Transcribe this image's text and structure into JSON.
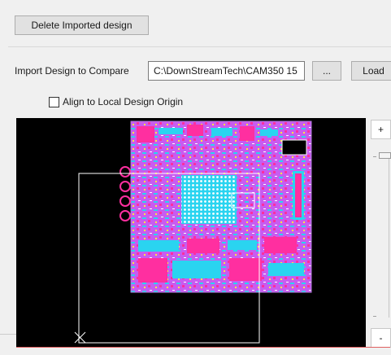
{
  "toolbar": {
    "delete_label": "Delete Imported design"
  },
  "import": {
    "label": "Import Design to Compare",
    "path_value": "C:\\DownStreamTech\\CAM350 15",
    "browse_label": "...",
    "load_label": "Load"
  },
  "options": {
    "align_label": "Align to Local Design Origin",
    "align_checked": false
  },
  "zoom": {
    "in_label": "+",
    "out_label": "-"
  },
  "colors": {
    "board": "#c85cf0",
    "copper_a": "#ff2fa0",
    "copper_b": "#2ad4f0",
    "overlay_outline": "#ffffff",
    "background": "#000000"
  }
}
